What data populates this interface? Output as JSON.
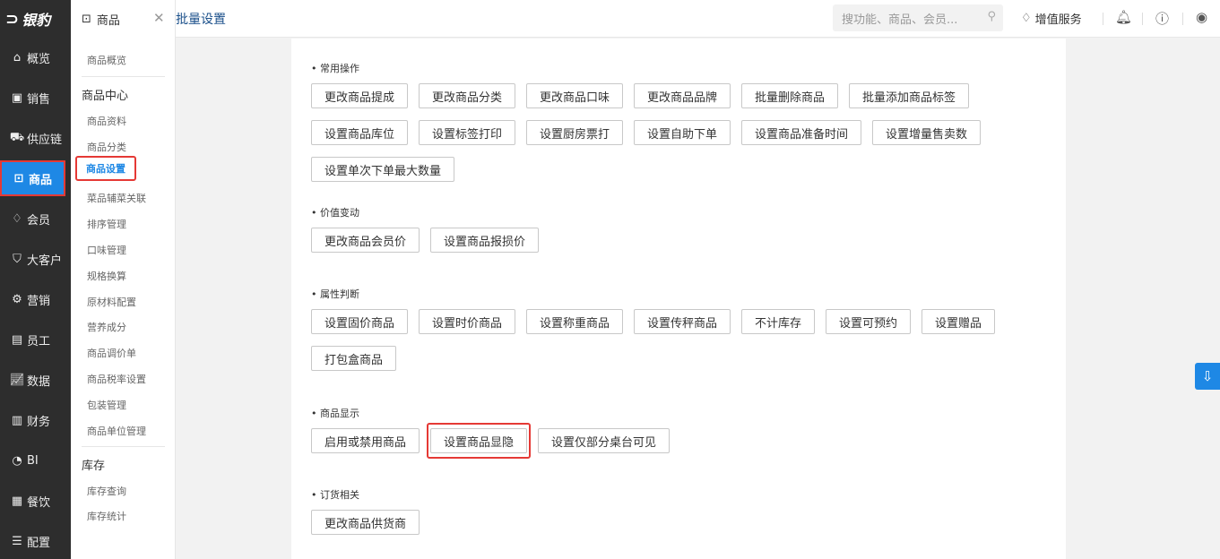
{
  "sidebar": {
    "logo_text": "银豹",
    "logo_icon": "panther-logo-icon",
    "items": [
      {
        "label": "概览",
        "icon": "home-icon"
      },
      {
        "label": "销售",
        "icon": "sales-icon"
      },
      {
        "label": "供应链",
        "icon": "supply-chain-icon"
      },
      {
        "label": "商品",
        "icon": "product-icon",
        "active": true
      },
      {
        "label": "会员",
        "icon": "member-icon"
      },
      {
        "label": "大客户",
        "icon": "key-account-icon"
      },
      {
        "label": "营销",
        "icon": "marketing-icon"
      },
      {
        "label": "员工",
        "icon": "staff-icon"
      },
      {
        "label": "数据",
        "icon": "data-icon"
      },
      {
        "label": "财务",
        "icon": "finance-icon"
      },
      {
        "label": "BI",
        "icon": "bi-icon"
      },
      {
        "label": "餐饮",
        "icon": "catering-icon"
      },
      {
        "label": "配置",
        "icon": "config-icon"
      }
    ]
  },
  "submenu": {
    "title": "商品",
    "items_top": [
      "商品概览"
    ],
    "group1": "商品中心",
    "items1": [
      "商品资料",
      "商品分类",
      "商品设置",
      "菜品辅菜关联",
      "排序管理",
      "口味管理",
      "规格换算",
      "原材料配置",
      "营养成分",
      "商品调价单",
      "商品税率设置",
      "包装管理",
      "商品单位管理"
    ],
    "selected": "商品设置",
    "group2": "库存",
    "items2": [
      "库存查询",
      "库存统计"
    ]
  },
  "topbar": {
    "breadcrumb": "批量设置",
    "search_placeholder": "搜功能、商品、会员...",
    "value_added": "增值服务"
  },
  "sections": [
    {
      "title": "常用操作",
      "buttons": [
        "更改商品提成",
        "更改商品分类",
        "更改商品口味",
        "更改商品品牌",
        "批量删除商品",
        "批量添加商品标签",
        "设置商品库位",
        "设置标签打印",
        "设置厨房票打",
        "设置自助下单",
        "设置商品准备时间",
        "设置增量售卖数",
        "设置单次下单最大数量"
      ]
    },
    {
      "title": "价值变动",
      "buttons": [
        "更改商品会员价",
        "设置商品报损价"
      ]
    },
    {
      "title": "属性判断",
      "buttons": [
        "设置固价商品",
        "设置时价商品",
        "设置称重商品",
        "设置传秤商品",
        "不计库存",
        "设置可预约",
        "设置赠品",
        "打包盒商品"
      ]
    },
    {
      "title": "商品显示",
      "buttons": [
        "启用或禁用商品",
        "设置商品显隐",
        "设置仅部分桌台可见"
      ]
    },
    {
      "title": "订货相关",
      "buttons": [
        "更改商品供货商"
      ]
    }
  ],
  "colors": {
    "accent": "#1e88e5",
    "highlight": "#e53935",
    "sidebar_bg": "#2d2d2d"
  }
}
